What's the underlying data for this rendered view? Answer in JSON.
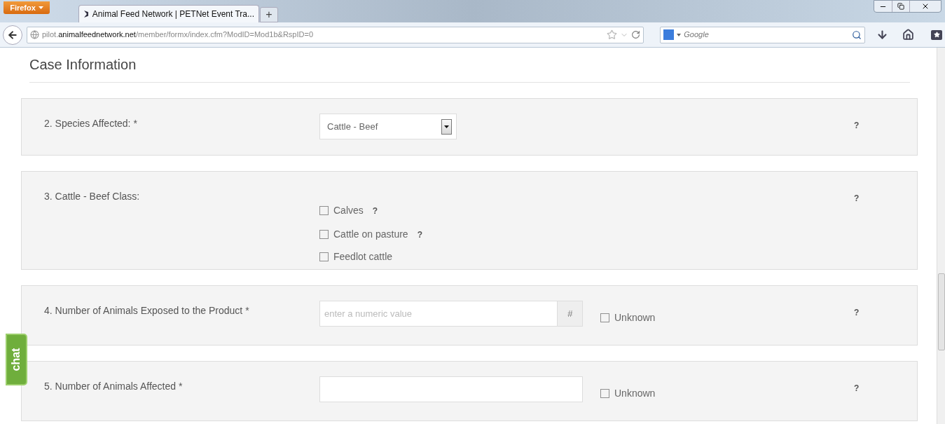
{
  "browser": {
    "menu_button": "Firefox",
    "tabs": [
      {
        "title": "Animal Feed Network | PETNet Event Tra...",
        "selected": true
      }
    ],
    "new_tab": "+",
    "url": {
      "prefix": "pilot.",
      "domain": "animalfeednetwork.net",
      "path": "/member/formx/index.cfm?ModID=Mod1b&RspID=0"
    },
    "search": {
      "placeholder": "Google"
    }
  },
  "page": {
    "heading": "Case Information",
    "questions": [
      {
        "kind": "select",
        "label": "2. Species Affected: *",
        "value": "Cattle - Beef",
        "help": "?"
      },
      {
        "kind": "checkboxes",
        "label": "3. Cattle - Beef Class:",
        "help": "?",
        "options": [
          {
            "label": "Calves",
            "checked": false,
            "help": "?"
          },
          {
            "label": "Cattle on pasture",
            "checked": false,
            "help": "?"
          },
          {
            "label": "Feedlot cattle",
            "checked": false
          }
        ]
      },
      {
        "kind": "number",
        "label": "4. Number of Animals Exposed to the Product *",
        "placeholder": "enter a numeric value",
        "addon": "#",
        "unknown": {
          "label": "Unknown",
          "checked": false
        },
        "help": "?"
      },
      {
        "kind": "text",
        "label": "5. Number of Animals Affected *",
        "unknown": {
          "label": "Unknown",
          "checked": false
        },
        "help": "?"
      }
    ]
  },
  "chat_tab": "chat"
}
